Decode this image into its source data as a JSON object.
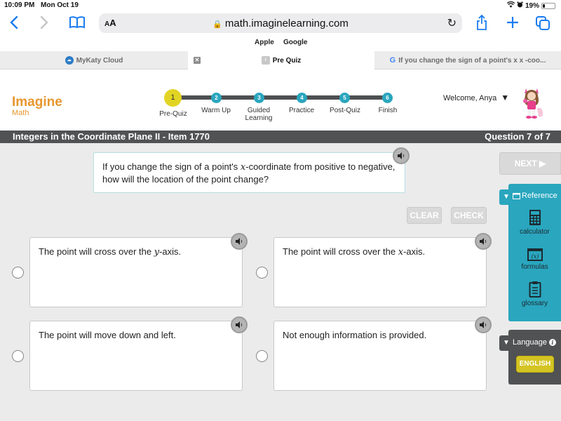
{
  "status_bar": {
    "time": "10:09 PM",
    "date": "Mon Oct 19",
    "battery_text": "19%",
    "battery_level": 0.19,
    "icons": [
      "wifi-icon",
      "alarm-icon",
      "battery-icon"
    ]
  },
  "browser": {
    "text_size_label": "AA",
    "url": "math.imaginelearning.com",
    "favorites": [
      "Apple",
      "Google"
    ],
    "tabs": [
      {
        "label": "MyKaty Cloud",
        "active": false,
        "icon": "mykaty-favicon"
      },
      {
        "label": "Pre Quiz",
        "active": true,
        "icon": "page-favicon"
      },
      {
        "label": "If you change the sign of a point's x x -coo...",
        "active": false,
        "icon": "google-favicon"
      }
    ]
  },
  "app": {
    "logo_main": "Imagine",
    "logo_sub": "Math",
    "steps": [
      {
        "number": "1",
        "label": "Pre-Quiz",
        "current": true
      },
      {
        "number": "2",
        "label": "Warm Up",
        "current": false
      },
      {
        "number": "3",
        "label": "Guided Learning",
        "current": false
      },
      {
        "number": "4",
        "label": "Practice",
        "current": false
      },
      {
        "number": "5",
        "label": "Post-Quiz",
        "current": false
      },
      {
        "number": "6",
        "label": "Finish",
        "current": false
      }
    ],
    "welcome": "Welcome, Anya",
    "lesson_title": "Integers in the Coordinate Plane II - Item 1770",
    "question_counter": "Question 7 of 7"
  },
  "question": {
    "text_before": "If you change the sign of a point's ",
    "variable": "x",
    "text_after": "-coordinate from positive to negative, how will the location of the point change?"
  },
  "buttons": {
    "next": "NEXT ▶",
    "clear": "CLEAR",
    "check": "CHECK"
  },
  "answers": [
    {
      "before": "The point will cross over the ",
      "variable": "y",
      "after": "-axis.",
      "selected": false
    },
    {
      "before": "The point will cross over the ",
      "variable": "x",
      "after": "-axis.",
      "selected": false
    },
    {
      "before": "The point will move down and left.",
      "variable": "",
      "after": "",
      "selected": false
    },
    {
      "before": "Not enough information is provided.",
      "variable": "",
      "after": "",
      "selected": false
    }
  ],
  "reference": {
    "title": "Reference",
    "items": [
      {
        "label": "calculator",
        "icon": "calculator-icon"
      },
      {
        "label": "formulas",
        "icon": "formulas-icon"
      },
      {
        "label": "glossary",
        "icon": "glossary-icon"
      }
    ]
  },
  "language": {
    "title": "Language",
    "selected": "ENGLISH"
  },
  "colors": {
    "accent_teal": "#2aa6be",
    "current_step_yellow": "#e2d424",
    "logo_orange": "#e7962d",
    "title_bar_gray": "#505253"
  }
}
